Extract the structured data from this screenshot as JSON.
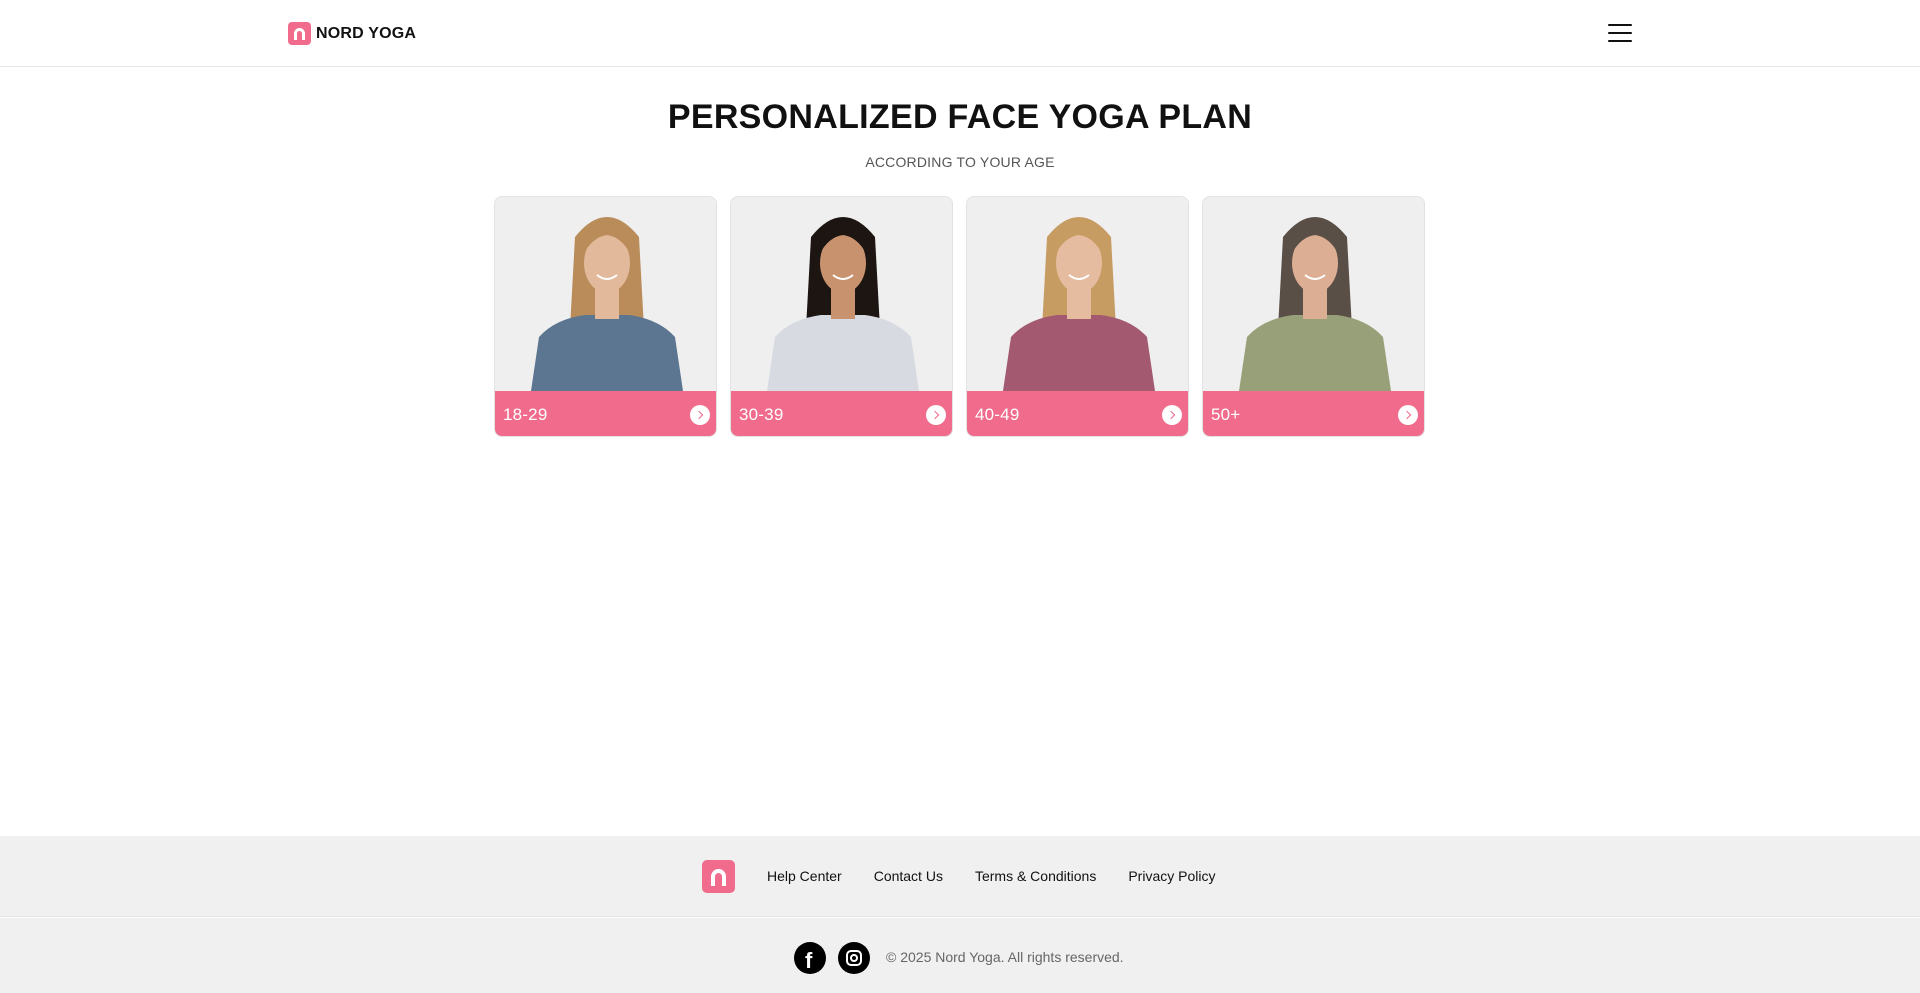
{
  "header": {
    "brand": "NORD YOGA",
    "menu_icon": "hamburger-menu-icon"
  },
  "main": {
    "title": "PERSONALIZED FACE YOGA PLAN",
    "subtitle": "ACCORDING TO YOUR AGE",
    "cards": [
      {
        "label": "18-29",
        "hair": "#b98c5a",
        "shirt": "#5c7590",
        "skin": "#e3b99b"
      },
      {
        "label": "30-39",
        "hair": "#1c1512",
        "shirt": "#d7dbe1",
        "skin": "#c7926d"
      },
      {
        "label": "40-49",
        "hair": "#c79c62",
        "shirt": "#a35a70",
        "skin": "#e6bca0"
      },
      {
        "label": "50+",
        "hair": "#5a4f47",
        "shirt": "#98a079",
        "skin": "#dcae93"
      }
    ]
  },
  "footer": {
    "links": [
      "Help Center",
      "Contact Us",
      "Terms & Conditions",
      "Privacy Policy"
    ],
    "social": [
      "facebook-icon",
      "instagram-icon"
    ],
    "copyright": "© 2025 Nord Yoga. All rights reserved."
  },
  "colors": {
    "accent": "#f06b8c",
    "footer_bg": "#f0f0f0"
  }
}
